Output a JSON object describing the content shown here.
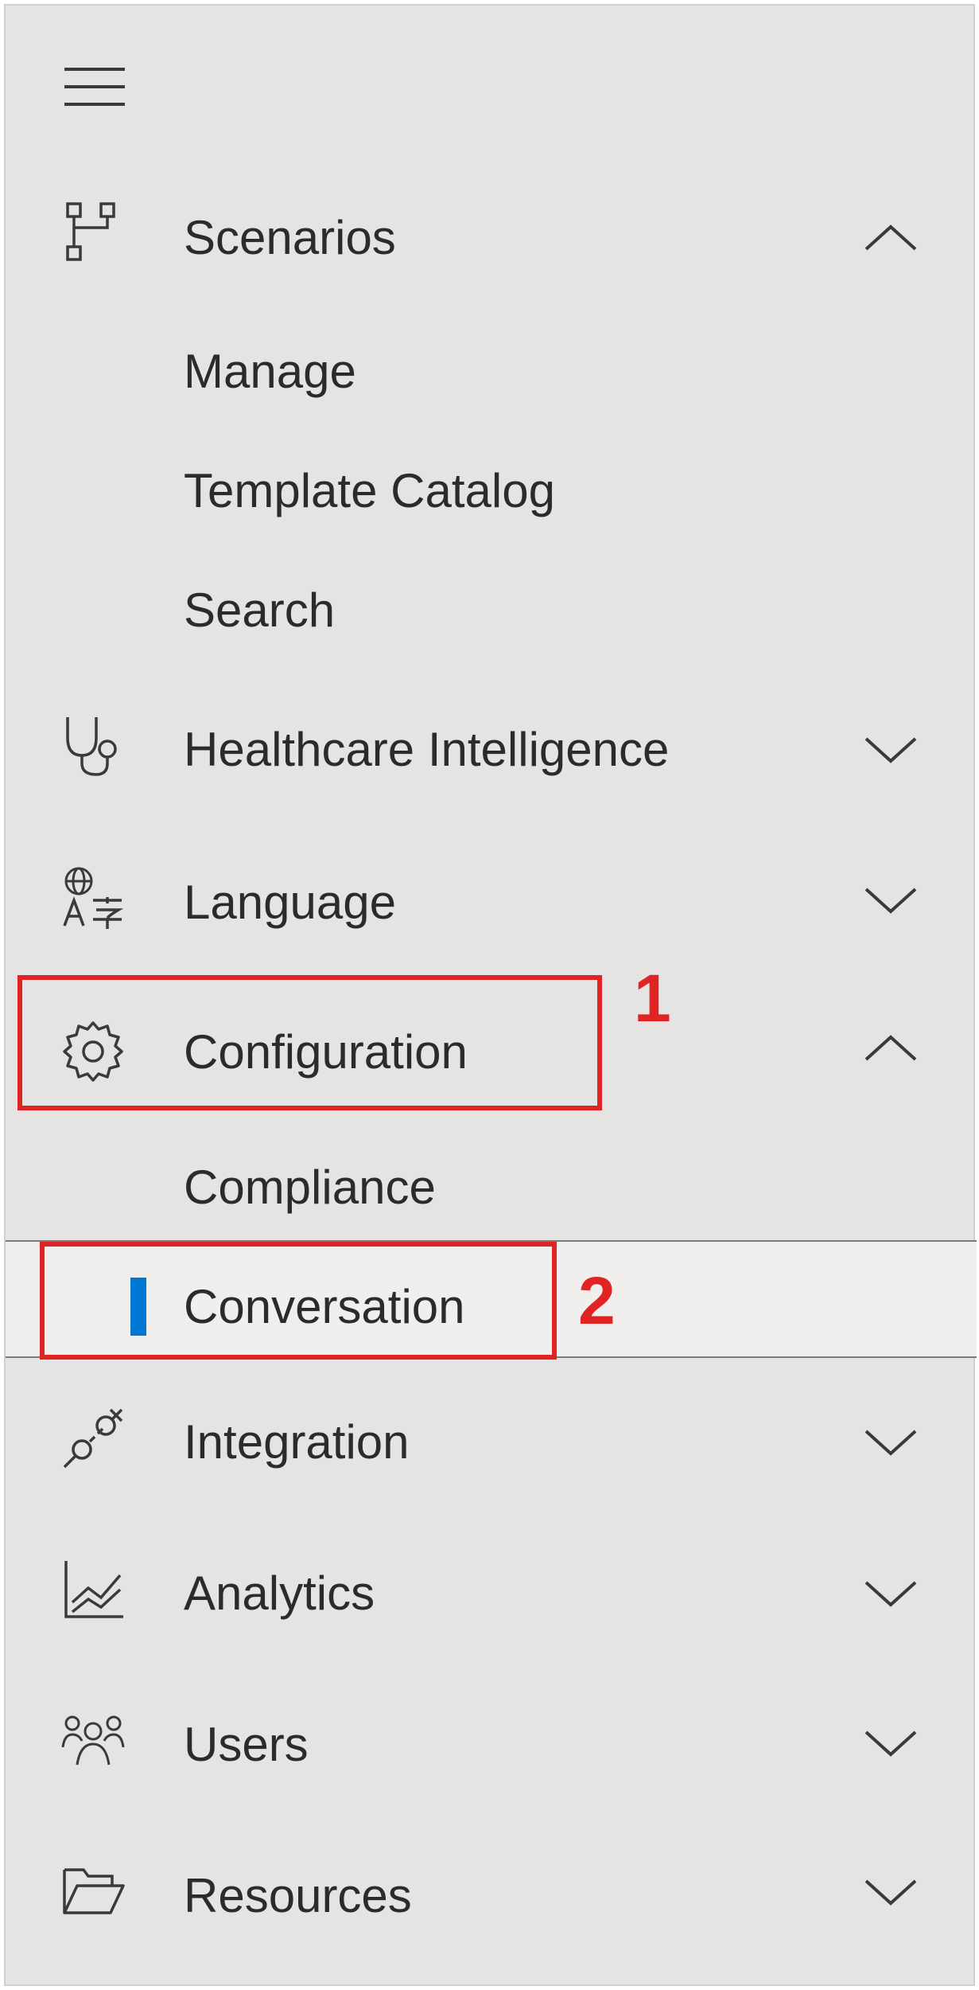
{
  "nav": {
    "menu_icon": "hamburger-menu-icon",
    "sections": [
      {
        "label": "Scenarios",
        "icon": "scenarios-flow-icon",
        "expanded": true,
        "chevron": "chevron-up-icon",
        "children": [
          "Manage",
          "Template Catalog",
          "Search"
        ]
      },
      {
        "label": "Healthcare Intelligence",
        "icon": "stethoscope-icon",
        "expanded": false,
        "chevron": "chevron-down-icon"
      },
      {
        "label": "Language",
        "icon": "language-translate-icon",
        "expanded": false,
        "chevron": "chevron-down-icon"
      },
      {
        "label": "Configuration",
        "icon": "gear-icon",
        "expanded": true,
        "chevron": "chevron-up-icon",
        "children": [
          "Compliance",
          "Conversation"
        ],
        "selected_child": "Conversation"
      },
      {
        "label": "Integration",
        "icon": "plug-icon",
        "expanded": false,
        "chevron": "chevron-down-icon"
      },
      {
        "label": "Analytics",
        "icon": "analytics-chart-icon",
        "expanded": false,
        "chevron": "chevron-down-icon"
      },
      {
        "label": "Users",
        "icon": "users-group-icon",
        "expanded": false,
        "chevron": "chevron-down-icon"
      },
      {
        "label": "Resources",
        "icon": "folder-open-icon",
        "expanded": false,
        "chevron": "chevron-down-icon"
      }
    ]
  },
  "annotations": {
    "step1": "1",
    "step2": "2",
    "color": "#e02424"
  },
  "colors": {
    "panel_bg": "#e6e4e3",
    "selected_indicator": "#0078d4",
    "text": "#2b2b2b"
  }
}
